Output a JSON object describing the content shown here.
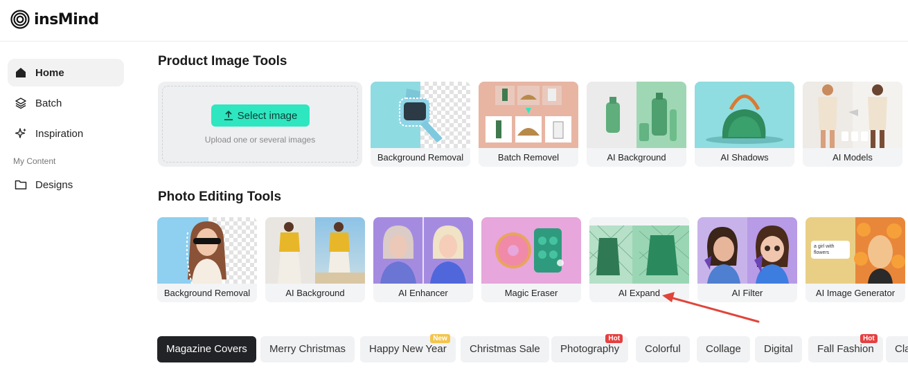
{
  "app": {
    "logo_text": "insMind"
  },
  "sidebar": {
    "items": [
      {
        "label": "Home",
        "icon": "home-icon"
      },
      {
        "label": "Batch",
        "icon": "layers-icon"
      },
      {
        "label": "Inspiration",
        "icon": "sparkle-icon"
      }
    ],
    "section_label": "My Content",
    "content_items": [
      {
        "label": "Designs",
        "icon": "folder-icon"
      }
    ]
  },
  "product_tools": {
    "title": "Product Image Tools",
    "upload": {
      "button_label": "Select image",
      "hint": "Upload one or several images"
    },
    "cards": [
      {
        "label": "Background Removal"
      },
      {
        "label": "Batch Removel"
      },
      {
        "label": "AI Background"
      },
      {
        "label": "AI Shadows"
      },
      {
        "label": "AI Models"
      }
    ]
  },
  "photo_tools": {
    "title": "Photo Editing Tools",
    "cards": [
      {
        "label": "Background Removal"
      },
      {
        "label": "AI Background"
      },
      {
        "label": "AI Enhancer"
      },
      {
        "label": "Magic Eraser"
      },
      {
        "label": "AI Expand"
      },
      {
        "label": "AI Filter"
      },
      {
        "label": "AI Image Generator",
        "prompt_text": "a girl with flowers"
      }
    ]
  },
  "categories": [
    {
      "label": "Magazine Covers",
      "active": true
    },
    {
      "label": "Merry Christmas"
    },
    {
      "label": "Happy New Year",
      "badge": "New"
    },
    {
      "label": "Christmas Sale"
    },
    {
      "label": "Photography",
      "badge": "Hot"
    },
    {
      "label": "Colorful"
    },
    {
      "label": "Collage"
    },
    {
      "label": "Digital"
    },
    {
      "label": "Fall Fashion",
      "badge": "Hot"
    },
    {
      "label": "Cla"
    }
  ],
  "colors": {
    "accent": "#2ee6c0",
    "annotation_arrow": "#e0453a",
    "hot_badge": "#e54040",
    "new_badge": "#f3c54c"
  }
}
